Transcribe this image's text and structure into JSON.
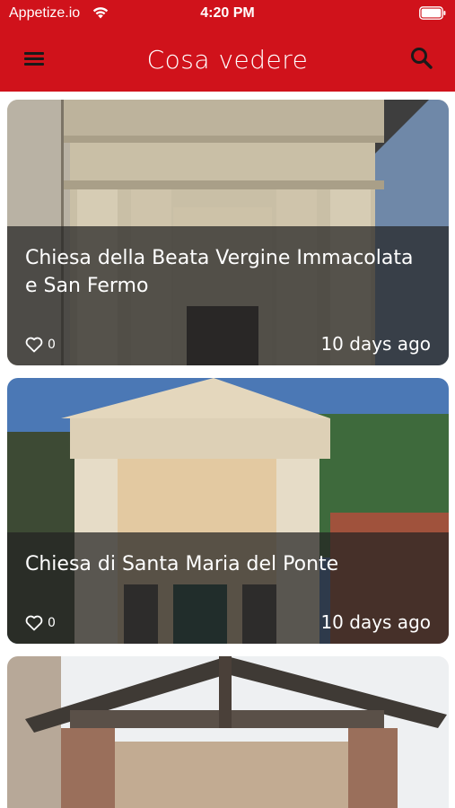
{
  "status_bar": {
    "carrier": "Appetize.io",
    "time": "4:20 PM"
  },
  "header": {
    "title": "Cosa vedere",
    "menu_icon": "hamburger-menu-icon",
    "search_icon": "search-icon",
    "background_color": "#d0121b"
  },
  "cards": [
    {
      "title": "Chiesa della Beata Vergine Immacolata e San Fermo",
      "likes": "0",
      "date": "10 days ago"
    },
    {
      "title": "Chiesa di Santa Maria del Ponte",
      "likes": "0",
      "date": "10 days ago"
    },
    {
      "title": "",
      "likes": "",
      "date": ""
    }
  ]
}
